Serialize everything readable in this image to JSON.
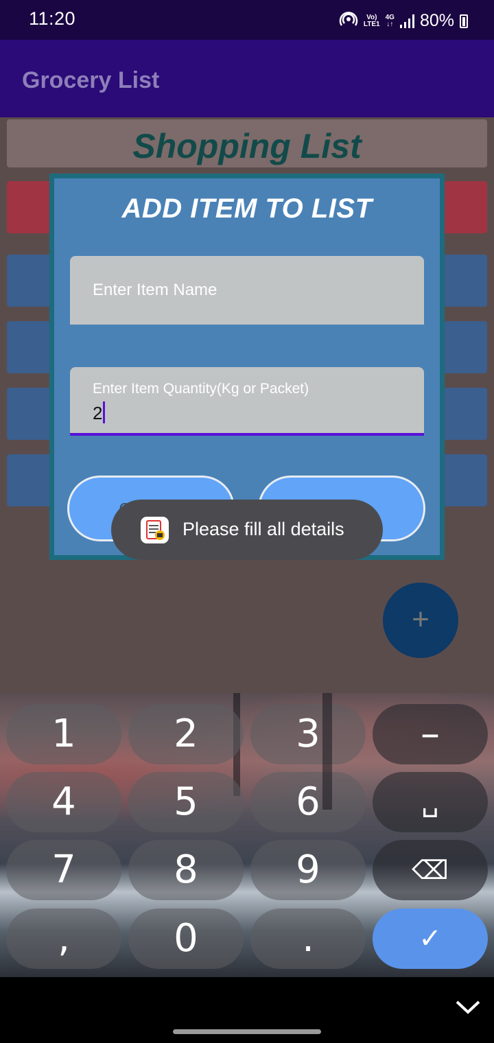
{
  "status_bar": {
    "time": "11:20",
    "volte_top": "Vo)",
    "volte_bottom": "LTE1",
    "network_type": "4G",
    "battery_percent": "80%",
    "icons": [
      "hotspot-icon",
      "volte-icon",
      "4g-icon",
      "signal-icon",
      "battery-icon"
    ]
  },
  "app_bar": {
    "title": "Grocery List"
  },
  "list": {
    "header": "Shopping List"
  },
  "fab": {
    "label": "+"
  },
  "dialog": {
    "title": "ADD ITEM TO LIST",
    "item_name_placeholder": "Enter Item Name",
    "item_name_value": "",
    "quantity_label": "Enter Item Quantity(Kg or Packet)",
    "quantity_value": "2",
    "cancel_label": "CANCEL",
    "add_label": "ADD"
  },
  "toast": {
    "message": "Please fill all details"
  },
  "keyboard": {
    "rows": [
      [
        "1",
        "2",
        "3",
        "–"
      ],
      [
        "4",
        "5",
        "6",
        "␣"
      ],
      [
        "7",
        "8",
        "9",
        "⌫"
      ],
      [
        ",",
        "0",
        ".",
        "✓"
      ]
    ]
  },
  "colors": {
    "status_bar": "#1a0642",
    "app_bar": "#2a0b77",
    "dialog": "#4a82b6",
    "dialog_border": "#1c6c7e",
    "button": "#61a4f8",
    "accent": "#5a11d8",
    "done_key": "#5a93ea"
  }
}
